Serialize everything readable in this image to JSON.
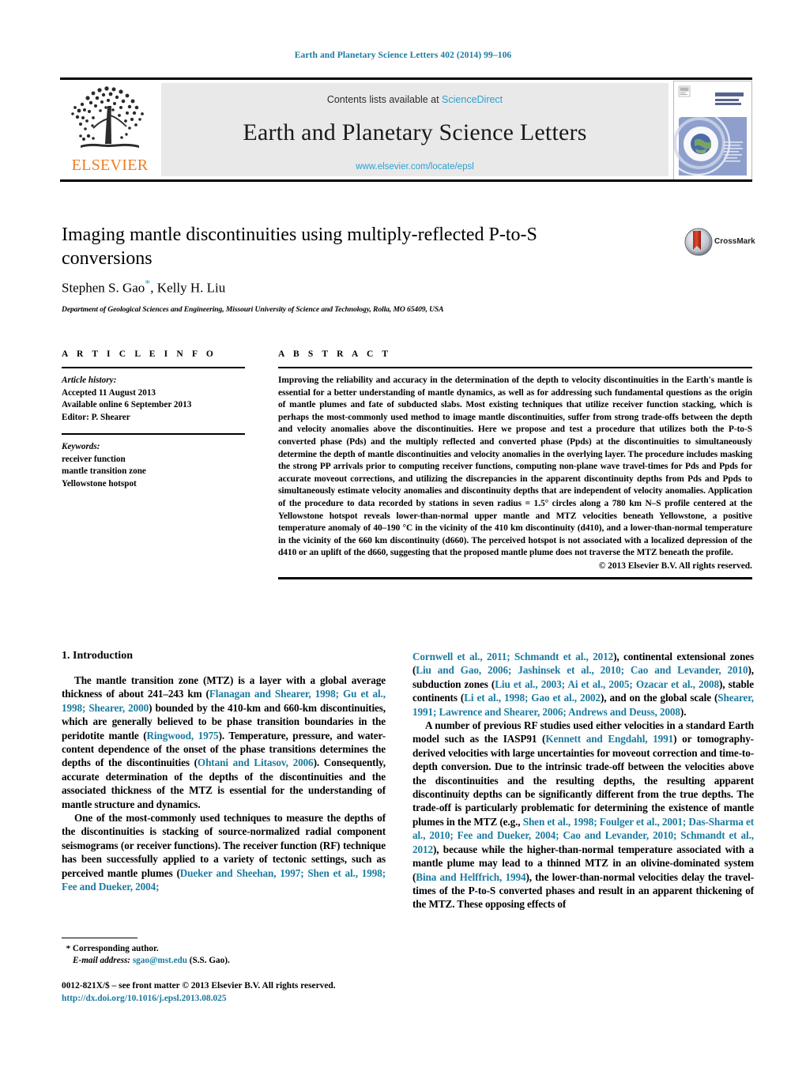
{
  "running_head": "Earth and Planetary Science Letters 402 (2014) 99–106",
  "masthead": {
    "contents_prefix": "Contents lists available at ",
    "sciencedirect": "ScienceDirect",
    "journal_name": "Earth and Planetary Science Letters",
    "url": "www.elsevier.com/locate/epsl",
    "publisher": "ELSEVIER",
    "cover_title_line1": "EARTH",
    "cover_title_line2": "AND PLANETARY",
    "cover_title_line3": "SCIENCE LETTERS"
  },
  "article": {
    "title": "Imaging mantle discontinuities using multiply-reflected P-to-S conversions",
    "crossmark_label": "CrossMark",
    "authors_pre": "Stephen S. Gao",
    "authors_post": ", Kelly H. Liu",
    "affiliation": "Department of Geological Sciences and Engineering, Missouri University of Science and Technology, Rolla, MO 65409, USA"
  },
  "info": {
    "heading": "A R T I C L E    I N F O",
    "history_label": "Article history:",
    "accepted": "Accepted 11 August 2013",
    "available": "Available online 6 September 2013",
    "editor": "Editor: P. Shearer",
    "keywords_label": "Keywords:",
    "keywords": [
      "receiver function",
      "mantle transition zone",
      "Yellowstone hotspot"
    ]
  },
  "abstract": {
    "heading": "A B S T R A C T",
    "body": "Improving the reliability and accuracy in the determination of the depth to velocity discontinuities in the Earth's mantle is essential for a better understanding of mantle dynamics, as well as for addressing such fundamental questions as the origin of mantle plumes and fate of subducted slabs. Most existing techniques that utilize receiver function stacking, which is perhaps the most-commonly used method to image mantle discontinuities, suffer from strong trade-offs between the depth and velocity anomalies above the discontinuities. Here we propose and test a procedure that utilizes both the P-to-S converted phase (Pds) and the multiply reflected and converted phase (Ppds) at the discontinuities to simultaneously determine the depth of mantle discontinuities and velocity anomalies in the overlying layer. The procedure includes masking the strong PP arrivals prior to computing receiver functions, computing non-plane wave travel-times for Pds and Ppds for accurate moveout corrections, and utilizing the discrepancies in the apparent discontinuity depths from Pds and Ppds to simultaneously estimate velocity anomalies and discontinuity depths that are independent of velocity anomalies. Application of the procedure to data recorded by stations in seven radius = 1.5° circles along a 780 km N–S profile centered at the Yellowstone hotspot reveals lower-than-normal upper mantle and MTZ velocities beneath Yellowstone, a positive temperature anomaly of 40–190 °C in the vicinity of the 410 km discontinuity (d410), and a lower-than-normal temperature in the vicinity of the 660 km discontinuity (d660). The perceived hotspot is not associated with a localized depression of the d410 or an uplift of the d660, suggesting that the proposed mantle plume does not traverse the MTZ beneath the profile.",
    "copyright": "© 2013 Elsevier B.V. All rights reserved."
  },
  "body": {
    "section_heading": "1. Introduction",
    "left_paragraphs": [
      {
        "segments": [
          {
            "t": "The mantle transition zone (MTZ) is a layer with a global average thickness of about 241–243 km (",
            "c": false
          },
          {
            "t": "Flanagan and Shearer, 1998; Gu et al., 1998; Shearer, 2000",
            "c": true
          },
          {
            "t": ") bounded by the 410-km and 660-km discontinuities, which are generally believed to be phase transition boundaries in the peridotite mantle (",
            "c": false
          },
          {
            "t": "Ringwood, 1975",
            "c": true
          },
          {
            "t": "). Temperature, pressure, and water-content dependence of the onset of the phase transitions determines the depths of the discontinuities (",
            "c": false
          },
          {
            "t": "Ohtani and Litasov, 2006",
            "c": true
          },
          {
            "t": "). Consequently, accurate determination of the depths of the discontinuities and the associated thickness of the MTZ is essential for the understanding of mantle structure and dynamics.",
            "c": false
          }
        ]
      },
      {
        "segments": [
          {
            "t": "One of the most-commonly used techniques to measure the depths of the discontinuities is stacking of source-normalized radial component seismograms (or receiver functions). The receiver function (RF) technique has been successfully applied to a variety of tectonic settings, such as perceived mantle plumes (",
            "c": false
          },
          {
            "t": "Dueker and Sheehan, 1997; Shen et al., 1998; Fee and Dueker, 2004;",
            "c": true
          }
        ]
      }
    ],
    "right_paragraphs": [
      {
        "segments": [
          {
            "t": "Cornwell et al., 2011; Schmandt et al., 2012",
            "c": true
          },
          {
            "t": "), continental extensional zones (",
            "c": false
          },
          {
            "t": "Liu and Gao, 2006; Jashinsek et al., 2010; Cao and Levander, 2010",
            "c": true
          },
          {
            "t": "), subduction zones (",
            "c": false
          },
          {
            "t": "Liu et al., 2003; Ai et al., 2005; Ozacar et al., 2008",
            "c": true
          },
          {
            "t": "), stable continents (",
            "c": false
          },
          {
            "t": "Li et al., 1998; Gao et al., 2002",
            "c": true
          },
          {
            "t": "), and on the global scale (",
            "c": false
          },
          {
            "t": "Shearer, 1991; Lawrence and Shearer, 2006; Andrews and Deuss, 2008",
            "c": true
          },
          {
            "t": ").",
            "c": false
          }
        ],
        "indent": false
      },
      {
        "segments": [
          {
            "t": "A number of previous RF studies used either velocities in a standard Earth model such as the IASP91 (",
            "c": false
          },
          {
            "t": "Kennett and Engdahl, 1991",
            "c": true
          },
          {
            "t": ") or tomography-derived velocities with large uncertainties for moveout correction and time-to-depth conversion. Due to the intrinsic trade-off between the velocities above the discontinuities and the resulting depths, the resulting apparent discontinuity depths can be significantly different from the true depths. The trade-off is particularly problematic for determining the existence of mantle plumes in the MTZ (e.g., ",
            "c": false
          },
          {
            "t": "Shen et al., 1998; Foulger et al., 2001; Das-Sharma et al., 2010; Fee and Dueker, 2004; Cao and Levander, 2010; Schmandt et al., 2012",
            "c": true
          },
          {
            "t": "), because while the higher-than-normal temperature associated with a mantle plume may lead to a thinned MTZ in an olivine-dominated system (",
            "c": false
          },
          {
            "t": "Bina and Helffrich, 1994",
            "c": true
          },
          {
            "t": "), the lower-than-normal velocities delay the travel-times of the P-to-S converted phases and result in an apparent thickening of the MTZ. These opposing effects of",
            "c": false
          }
        ],
        "indent": true
      }
    ]
  },
  "footnote": {
    "star": "*",
    "corresponding": "Corresponding author.",
    "email_label": "E-mail address:",
    "email": "sgao@mst.edu",
    "email_suffix": "(S.S. Gao)."
  },
  "colophon": {
    "issn_line": "0012-821X/$ – see front matter  © 2013 Elsevier B.V. All rights reserved.",
    "doi": "http://dx.doi.org/10.1016/j.epsl.2013.08.025"
  },
  "colors": {
    "link": "#1b7ba0",
    "sciencedirect": "#2e9fd0",
    "elsevier_orange": "#ef7d22",
    "masthead_bg": "#e9e9e9"
  }
}
